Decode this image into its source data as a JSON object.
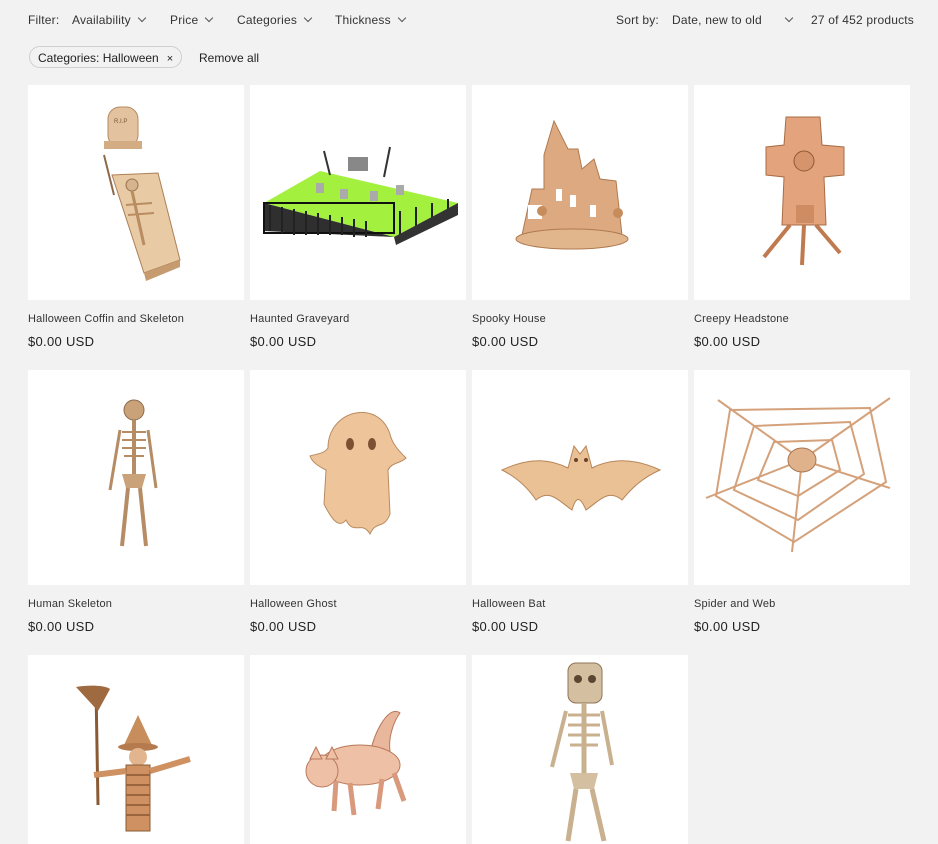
{
  "filter": {
    "label": "Filter:",
    "items": [
      "Availability",
      "Price",
      "Categories",
      "Thickness"
    ]
  },
  "sort": {
    "label": "Sort by:",
    "value": "Date, new to old",
    "count": "27 of 452 products"
  },
  "active_filter": {
    "label": "Categories: Halloween",
    "remove_symbol": "×",
    "remove_all": "Remove all"
  },
  "products": [
    {
      "title": "Halloween Coffin and Skeleton",
      "price": "$0.00 USD"
    },
    {
      "title": "Haunted Graveyard",
      "price": "$0.00 USD"
    },
    {
      "title": "Spooky House",
      "price": "$0.00 USD"
    },
    {
      "title": "Creepy Headstone",
      "price": "$0.00 USD"
    },
    {
      "title": "Human Skeleton",
      "price": "$0.00 USD"
    },
    {
      "title": "Halloween Ghost",
      "price": "$0.00 USD"
    },
    {
      "title": "Halloween Bat",
      "price": "$0.00 USD"
    },
    {
      "title": "Spider and Web",
      "price": "$0.00 USD"
    },
    {
      "title": "",
      "price": ""
    },
    {
      "title": "",
      "price": ""
    },
    {
      "title": "",
      "price": ""
    }
  ]
}
